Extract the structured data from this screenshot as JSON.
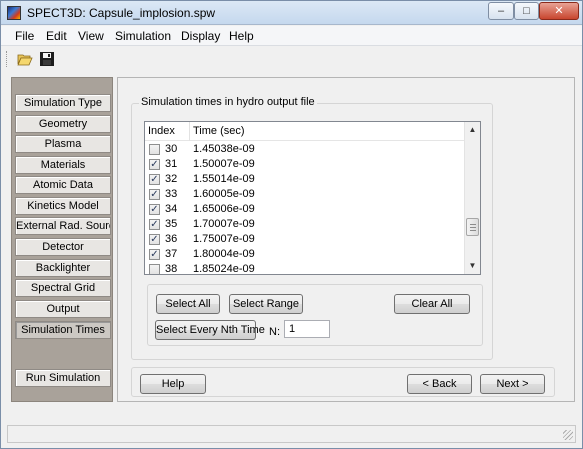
{
  "window": {
    "title": "SPECT3D:  Capsule_implosion.spw",
    "controls": {
      "minimize": "–",
      "maximize": "□",
      "close": "✕"
    }
  },
  "menu": {
    "items": [
      {
        "label": "File"
      },
      {
        "label": "Edit"
      },
      {
        "label": "View"
      },
      {
        "label": "Simulation"
      },
      {
        "label": "Display"
      },
      {
        "label": "Help"
      }
    ]
  },
  "toolbar": {
    "icons": [
      "open-folder-icon",
      "save-disk-icon"
    ]
  },
  "sidebar": {
    "items": [
      {
        "label": "Simulation Type"
      },
      {
        "label": "Geometry"
      },
      {
        "label": "Plasma"
      },
      {
        "label": "Materials"
      },
      {
        "label": "Atomic Data"
      },
      {
        "label": "Kinetics Model"
      },
      {
        "label": "External Rad. Source"
      },
      {
        "label": "Detector"
      },
      {
        "label": "Backlighter"
      },
      {
        "label": "Spectral Grid"
      },
      {
        "label": "Output"
      },
      {
        "label": "Simulation Times",
        "active": true
      }
    ],
    "run_label": "Run Simulation"
  },
  "main": {
    "group_title": "Simulation times in hydro output file",
    "columns": {
      "index": "Index",
      "time": "Time (sec)"
    },
    "rows": [
      {
        "index": "30",
        "time": "1.45038e-09",
        "checked": false
      },
      {
        "index": "31",
        "time": "1.50007e-09",
        "checked": true
      },
      {
        "index": "32",
        "time": "1.55014e-09",
        "checked": true
      },
      {
        "index": "33",
        "time": "1.60005e-09",
        "checked": true
      },
      {
        "index": "34",
        "time": "1.65006e-09",
        "checked": true
      },
      {
        "index": "35",
        "time": "1.70007e-09",
        "checked": true
      },
      {
        "index": "36",
        "time": "1.75007e-09",
        "checked": true
      },
      {
        "index": "37",
        "time": "1.80004e-09",
        "checked": true
      },
      {
        "index": "38",
        "time": "1.85024e-09",
        "checked": false
      }
    ],
    "buttons": {
      "select_all": "Select All",
      "select_range": "Select Range",
      "clear_all": "Clear All",
      "select_nth": "Select Every Nth Time"
    },
    "n_label": "N:",
    "n_value": "1"
  },
  "nav": {
    "help": "Help",
    "back": "< Back",
    "next": "Next >"
  },
  "colors": {
    "sidebar_bg": "#a9a29a",
    "window_bg": "#f0f0f0"
  }
}
